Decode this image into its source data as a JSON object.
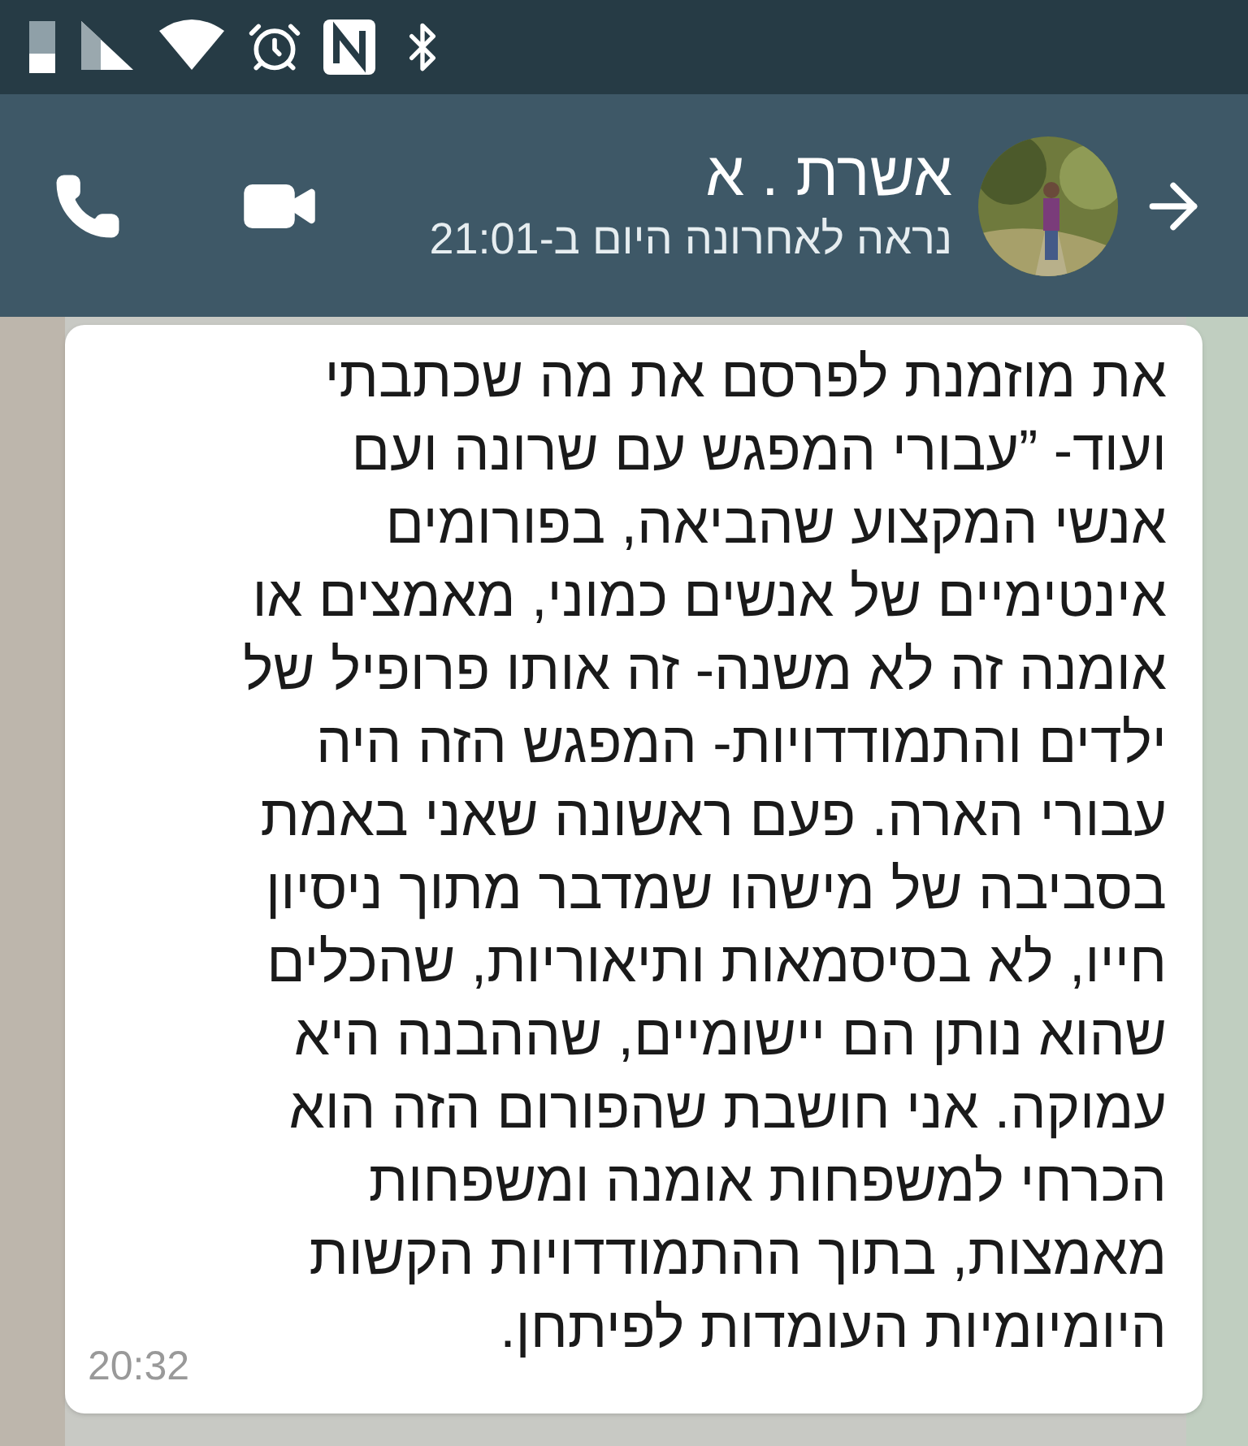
{
  "header": {
    "contact_name": "אשרת . א",
    "last_seen": "נראה לאחרונה היום ב-21:01"
  },
  "message": {
    "lines": [
      "את מוזמנת לפרסם את מה שכתבתי",
      "ועוד-  ”עבורי המפגש עם שרונה ועם",
      "אנשי המקצוע שהביאה, בפורומים",
      "אינטימיים של אנשים כמוני, מאמצים או",
      "אומנה זה לא משנה- זה אותו פרופיל של",
      "ילדים והתמודדויות- המפגש הזה היה",
      "עבורי הארה. פעם ראשונה שאני באמת",
      "בסביבה של מישהו שמדבר מתוך ניסיון",
      "חייו, לא בסיסמאות ותיאוריות, שהכלים",
      "שהוא נותן הם יישומיים, שההבנה היא",
      "עמוקה. אני חושבת שהפורום הזה הוא",
      "הכרחי למשפחות אומנה ומשפחות",
      "מאמצות, בתוך ההתמודדויות הקשות",
      "היומיומיות העומדות לפיתחן."
    ],
    "time": "20:32"
  }
}
